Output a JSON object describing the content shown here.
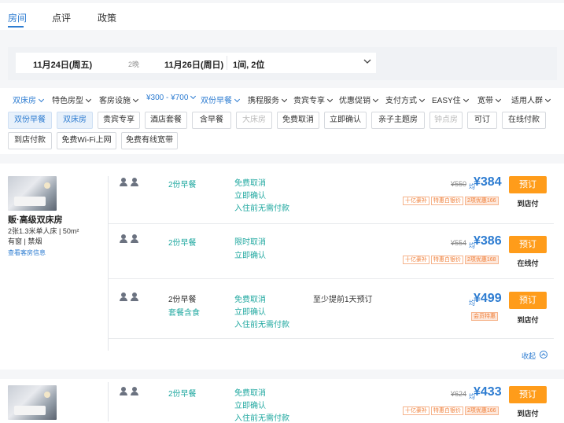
{
  "tabs": [
    "房间",
    "点评",
    "政策"
  ],
  "search": {
    "checkin": "11月24日(周五)",
    "nights": "2晚",
    "checkout": "11月26日(周日)",
    "rooms": "1间, 2位"
  },
  "filters": [
    "双床房",
    "特色房型",
    "客房设施",
    "¥300 - ¥700",
    "双份早餐",
    "携程服务",
    "贵宾专享",
    "优惠促销",
    "支付方式",
    "EASY住",
    "宽带",
    "适用人群"
  ],
  "tags": [
    "双份早餐",
    "双床房",
    "贵宾专享",
    "酒店套餐",
    "含早餐",
    "大床房",
    "免费取消",
    "立即确认",
    "亲子主题房",
    "钟点房",
    "可订",
    "在线付款",
    "到店付款",
    "免费Wi-Fi上网",
    "免费有线宽带"
  ],
  "room1": {
    "title": "贩·高级双床房",
    "bed": "2张1.3米单人床 | 50m²",
    "window": "有窗 | 禁烟",
    "link": "查看客房信息",
    "offers": [
      {
        "breakfast": "2份早餐",
        "policies": [
          "免费取消",
          "立即确认",
          "入住前无需付款"
        ],
        "orig": "¥550",
        "curr": "均",
        "price": "¥384",
        "badges": [
          "十亿豪补",
          "特惠白银价",
          "2项优惠166"
        ],
        "book": "预订",
        "pay": "到店付"
      },
      {
        "breakfast": "2份早餐",
        "policies": [
          "限时取消",
          "立即确认"
        ],
        "orig": "¥554",
        "curr": "均",
        "price": "¥386",
        "badges": [
          "十亿豪补",
          "特惠白银价",
          "2项优惠168"
        ],
        "book": "预订",
        "pay": "在线付"
      },
      {
        "breakfast": "2份早餐",
        "breakfast2": "套餐含食",
        "policies": [
          "免费取消",
          "立即确认",
          "入住前无需付款"
        ],
        "note": "至少提前1天预订",
        "curr": "均",
        "price": "¥499",
        "badges": [
          "会员特惠"
        ],
        "book": "预订",
        "pay": "到店付"
      }
    ],
    "collapse": "收起"
  },
  "room2": {
    "offer": {
      "breakfast": "2份早餐",
      "policies": [
        "免费取消",
        "立即确认",
        "入住前无需付款"
      ],
      "orig": "¥624",
      "curr": "均",
      "price": "¥433",
      "badges": [
        "十亿豪补",
        "特惠白银价",
        "2项优惠166"
      ],
      "book": "预订",
      "pay": "到店付"
    }
  },
  "colors": {
    "accent": "#2d7cd1",
    "teal": "#20a8a0",
    "orange": "#ff9c1a",
    "badge": "#f0813c"
  }
}
